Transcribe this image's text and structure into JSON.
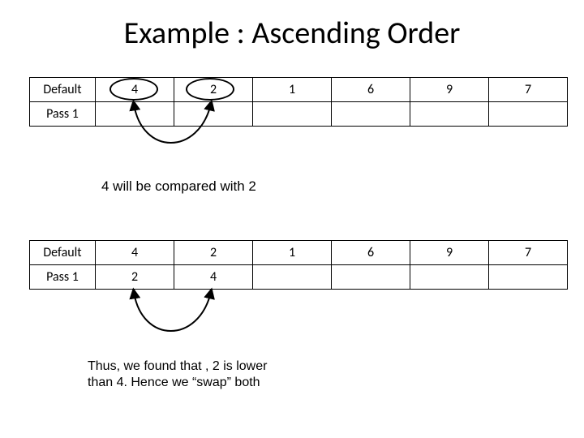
{
  "title": "Example : Ascending Order",
  "table1": {
    "row0": {
      "label": "Default",
      "c0": "4",
      "c1": "2",
      "c2": "1",
      "c3": "6",
      "c4": "9",
      "c5": "7"
    },
    "row1": {
      "label": "Pass 1"
    }
  },
  "caption1": "4 will be compared with 2",
  "table2": {
    "row0": {
      "label": "Default",
      "c0": "4",
      "c1": "2",
      "c2": "1",
      "c3": "6",
      "c4": "9",
      "c5": "7"
    },
    "row1": {
      "label": "Pass 1",
      "c0": "2",
      "c1": "4"
    }
  },
  "caption2": "Thus, we found that , 2 is lower than 4. Hence we “swap” both"
}
